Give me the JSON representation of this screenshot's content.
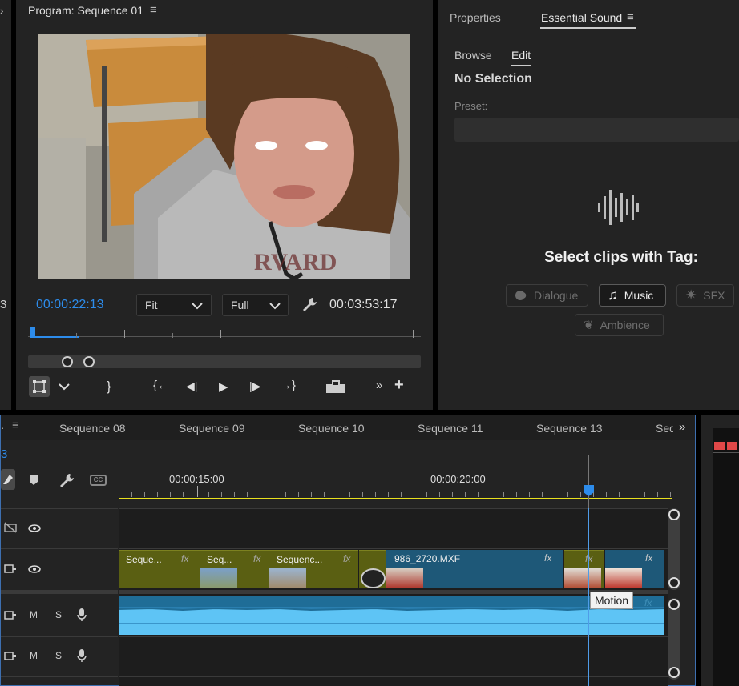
{
  "program_monitor": {
    "title": "Program: Sequence 01",
    "timecode_current": "00:00:22:13",
    "fit_label": "Fit",
    "quality_label": "Full",
    "timecode_duration": "00:03:53:17",
    "left_edge_digit": "3"
  },
  "essential_sound": {
    "tab_properties": "Properties",
    "tab_essential_sound": "Essential Sound",
    "subtab_browse": "Browse",
    "subtab_edit": "Edit",
    "no_selection": "No Selection",
    "preset_label": "Preset:",
    "select_tag_title": "Select clips with Tag:",
    "tags": [
      "Dialogue",
      "Music",
      "SFX",
      "Ambience"
    ]
  },
  "timeline": {
    "tabs": [
      "Sequence 08",
      "Sequence 09",
      "Sequence 10",
      "Sequence 11",
      "Sequence 13",
      "Seq"
    ],
    "left_digit": "3",
    "ruler_labels": [
      "00:00:15:00",
      "00:00:20:00"
    ],
    "audio_track_m": "M",
    "audio_track_s": "S",
    "clips": [
      {
        "name": "Seque...",
        "fx": "fx"
      },
      {
        "name": "Seq...",
        "fx": "fx"
      },
      {
        "name": "Sequenc...",
        "fx": "fx"
      },
      {
        "name": "986_2720.MXF",
        "fx": "fx"
      },
      {
        "name": "",
        "fx": "fx"
      },
      {
        "name": "",
        "fx": "fx"
      }
    ],
    "audio_fx": "fx",
    "tooltip": "Motion"
  },
  "colors": {
    "accent_blue": "#2d8ceb",
    "clip_yellow": "#5a5f12",
    "clip_blue": "#1e5878",
    "audio_wave": "#5ec4f5",
    "work_area": "#e8e01e"
  }
}
